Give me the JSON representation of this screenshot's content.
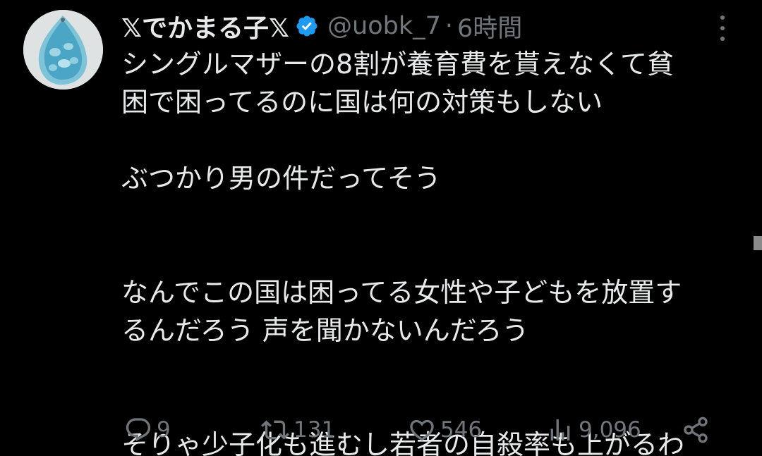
{
  "tweet": {
    "display_name": "𝕏でかまる子𝕏",
    "handle": "@uobk_7",
    "separator": "·",
    "time": "6時間",
    "paragraphs": [
      "シングルマザーの8割が養育費を貰えなくて貧\n困で困ってるのに国は何の対策もしない",
      "ぶつかり男の件だってそう",
      "なんでこの国は困ってる女性や子どもを放置す\nるんだろう 声を聞かないんだろう",
      "そりゃ少子化も進むし若者の自殺率も上がるわ"
    ]
  },
  "actions": {
    "reply": {
      "icon": "reply-icon",
      "count": "9"
    },
    "retweet": {
      "icon": "retweet-icon",
      "count": "131"
    },
    "like": {
      "icon": "heart-icon",
      "count": "546"
    },
    "views": {
      "icon": "views-icon",
      "count": "9,096"
    },
    "share": {
      "icon": "share-icon"
    }
  },
  "colors": {
    "background": "#000000",
    "text": "#e7e9ea",
    "muted": "#71767b",
    "verified": "#1d9bf0"
  }
}
